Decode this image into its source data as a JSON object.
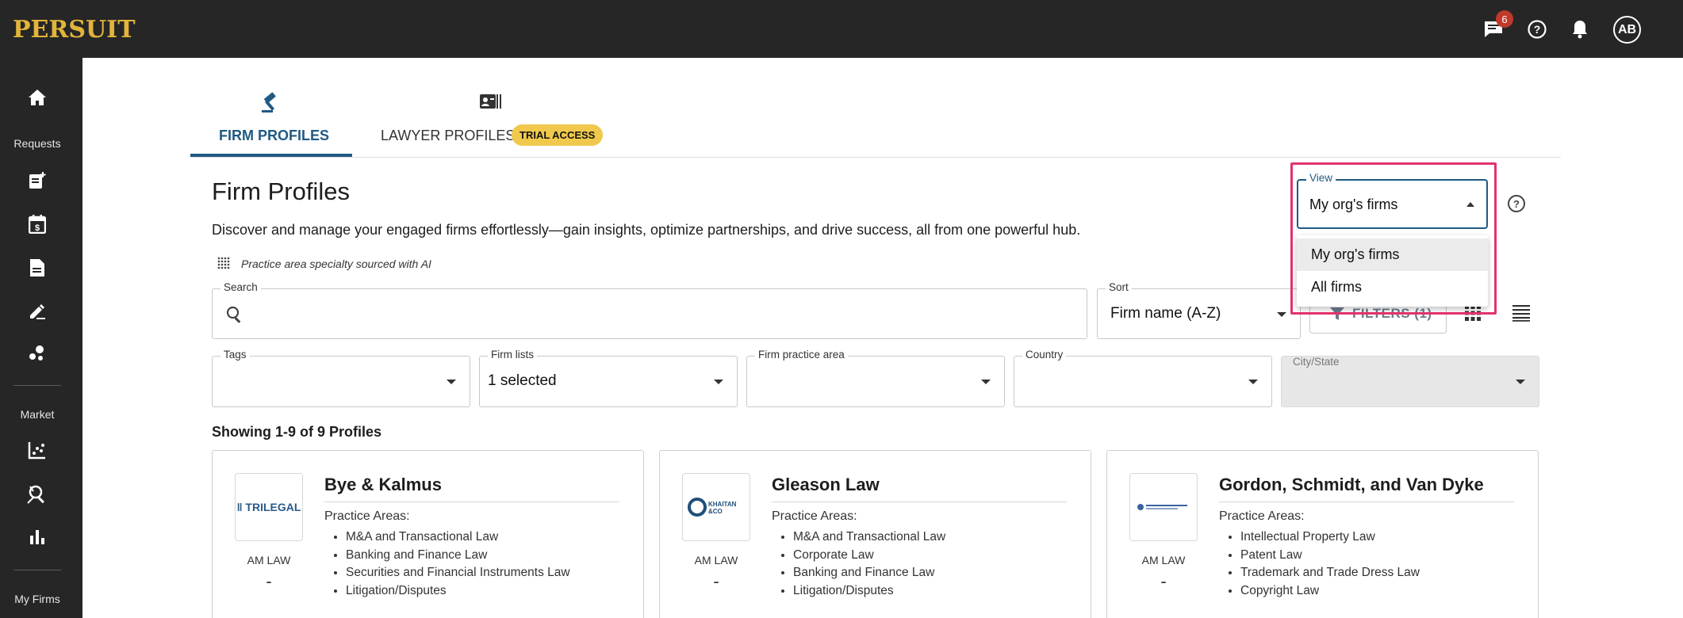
{
  "app": {
    "logo": "PERSUIT"
  },
  "topbar": {
    "messages_badge": "6",
    "avatar_initials": "AB"
  },
  "sidebar": {
    "section_requests": "Requests",
    "section_market": "Market",
    "section_my_firms": "My Firms"
  },
  "tabs": [
    {
      "label": "FIRM PROFILES",
      "active": true
    },
    {
      "label": "LAWYER PROFILES",
      "badge": "TRIAL ACCESS",
      "active": false
    }
  ],
  "page": {
    "title": "Firm Profiles",
    "description": "Discover and manage your engaged firms effortlessly—gain insights, optimize partnerships, and drive success, all from one powerful hub.",
    "ai_note": "Practice area specialty sourced with AI"
  },
  "controls": {
    "search": {
      "label": "Search",
      "value": ""
    },
    "sort": {
      "label": "Sort",
      "value": "Firm name (A-Z)"
    },
    "filters_label": "FILTERS (1)",
    "view": {
      "label": "View",
      "value": "My org's firms",
      "options": [
        "My org's firms",
        "All firms"
      ]
    }
  },
  "filters": {
    "tags": {
      "label": "Tags",
      "value": ""
    },
    "firm_lists": {
      "label": "Firm lists",
      "value": "1 selected"
    },
    "practice_area": {
      "label": "Firm practice area",
      "value": ""
    },
    "country": {
      "label": "Country",
      "value": ""
    },
    "city_state": {
      "label": "City/State",
      "value": ""
    }
  },
  "results": {
    "showing": "Showing 1-9 of 9 Profiles",
    "cards": [
      {
        "name": "Bye & Kalmus",
        "logo_text": "TRILEGAL",
        "am_law": "AM LAW",
        "am_law_value": "-",
        "practice_areas_label": "Practice Areas:",
        "practice_areas": [
          "M&A and Transactional Law",
          "Banking and Finance Law",
          "Securities and Financial Instruments Law",
          "Litigation/Disputes"
        ]
      },
      {
        "name": "Gleason Law",
        "logo_text": "KHAITAN & CO",
        "am_law": "AM LAW",
        "am_law_value": "-",
        "practice_areas_label": "Practice Areas:",
        "practice_areas": [
          "M&A and Transactional Law",
          "Corporate Law",
          "Banking and Finance Law",
          "Litigation/Disputes"
        ]
      },
      {
        "name": "Gordon, Schmidt, and Van Dyke",
        "logo_text": "",
        "am_law": "AM LAW",
        "am_law_value": "-",
        "practice_areas_label": "Practice Areas:",
        "practice_areas": [
          "Intellectual Property Law",
          "Patent Law",
          "Trademark and Trade Dress Law",
          "Copyright Law"
        ]
      }
    ]
  },
  "colors": {
    "accent": "#1f5a83",
    "highlight": "#e2336b",
    "logo": "#e2b53a",
    "badge": "#f0c94c"
  }
}
